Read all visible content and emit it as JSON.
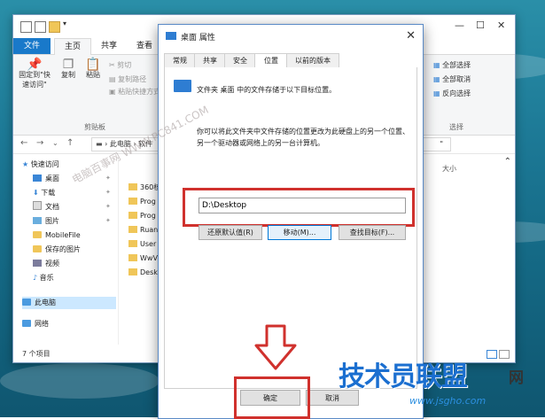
{
  "explorer": {
    "tabs": [
      "文件",
      "主页",
      "共享",
      "查看"
    ],
    "ribbon": {
      "pin": "固定到\"快\n速访问\"",
      "copy": "复制",
      "paste": "粘贴",
      "cut": "剪切",
      "copy_path": "复制路径",
      "paste_shortcut": "粘贴快捷方式",
      "clipboard_group": "剪贴板",
      "select_all": "全部选择",
      "select_none": "全部取消",
      "invert_select": "反向选择",
      "select_group": "选择"
    },
    "address": "› 此电脑 › 软件",
    "address_tail": "\"",
    "tree": [
      "快速访问",
      "桌面",
      "下载",
      "文档",
      "图片",
      "MobileFile",
      "保存的图片",
      "视频",
      "音乐",
      "此电脑",
      "网络"
    ],
    "files": [
      "360核",
      "Prog",
      "Prog",
      "Ruan",
      "User",
      "WwV",
      "Desk"
    ],
    "col_size": "大小",
    "status": "7 个项目"
  },
  "dialog": {
    "title": "桌面 属性",
    "tabs": [
      "常规",
      "共享",
      "安全",
      "位置",
      "以前的版本"
    ],
    "desc1": "文件夹 桌面 中的文件存储于以下目标位置。",
    "desc2": "你可以将此文件夹中文件存储的位置更改为此硬盘上的另一个位置、另一个驱动器或网络上的另一台计算机。",
    "path_value": "D:\\Desktop",
    "buttons": {
      "restore": "还原默认值(R)",
      "move": "移动(M)...",
      "find_target": "查找目标(F)..."
    },
    "footer": {
      "ok": "确定",
      "cancel": "取消"
    }
  },
  "watermark": "电脑百事网 WWW.PC841.COM",
  "logo": {
    "text": "技术员联盟",
    "net": "网",
    "url": "www.jsgho.com"
  },
  "colors": {
    "accent": "#1979ca",
    "highlight": "#d0312d",
    "logo": "#1b6fd0"
  }
}
